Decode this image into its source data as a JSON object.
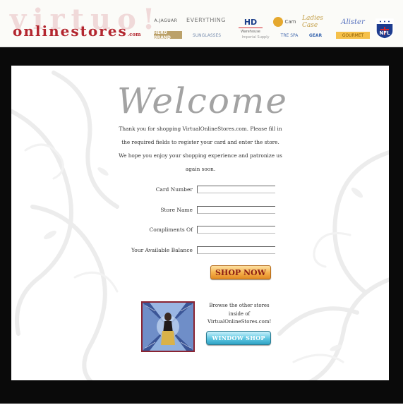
{
  "header": {
    "logo_top": "virtuo!",
    "logo_bottom": "onlinestores",
    "logo_com": ".com",
    "brands": [
      {
        "name": "b1",
        "text": "A.JAGUAR"
      },
      {
        "name": "b2",
        "text": "HERO BRAND"
      },
      {
        "name": "b3",
        "text": "EVERYTHING"
      },
      {
        "name": "b4",
        "text": "SUNGLASSES"
      },
      {
        "name": "b5",
        "text": "HD",
        "sub": "Warehouse"
      },
      {
        "name": "b6",
        "text": "Imperial Supply"
      },
      {
        "name": "b7",
        "text": "Cam"
      },
      {
        "name": "b8",
        "text": "TRE SPA"
      },
      {
        "name": "b9",
        "text": "Ladies Case"
      },
      {
        "name": "b10",
        "text": "GEAR"
      },
      {
        "name": "b11",
        "text": "Alister"
      },
      {
        "name": "b12",
        "text": "GOURMET"
      },
      {
        "name": "b13",
        "text": "NFL"
      }
    ]
  },
  "main": {
    "welcome": "Welcome",
    "intro": "Thank you for shopping VirtualOnlineStores.com. Please fill in the required fields to register your card and enter the store. We hope you enjoy your shopping experience and patronize us again soon.",
    "form": {
      "card_number_label": "Card Number",
      "store_name_label": "Store Name",
      "compliments_label": "Compliments Of",
      "balance_label": "Your Available Balance"
    },
    "shop_now_label": "SHOP NOW",
    "browse_text": "Browse the other stores inside of VirtualOnlineStores.com!",
    "window_shop_label": "WINDOW SHOP"
  },
  "colors": {
    "frame": "#0a0a0a",
    "logo_red": "#b3262f",
    "welcome_gray": "#a3a3a3",
    "shop_now_orange": "#f6b34f",
    "window_shop_blue": "#5fc7e2"
  }
}
